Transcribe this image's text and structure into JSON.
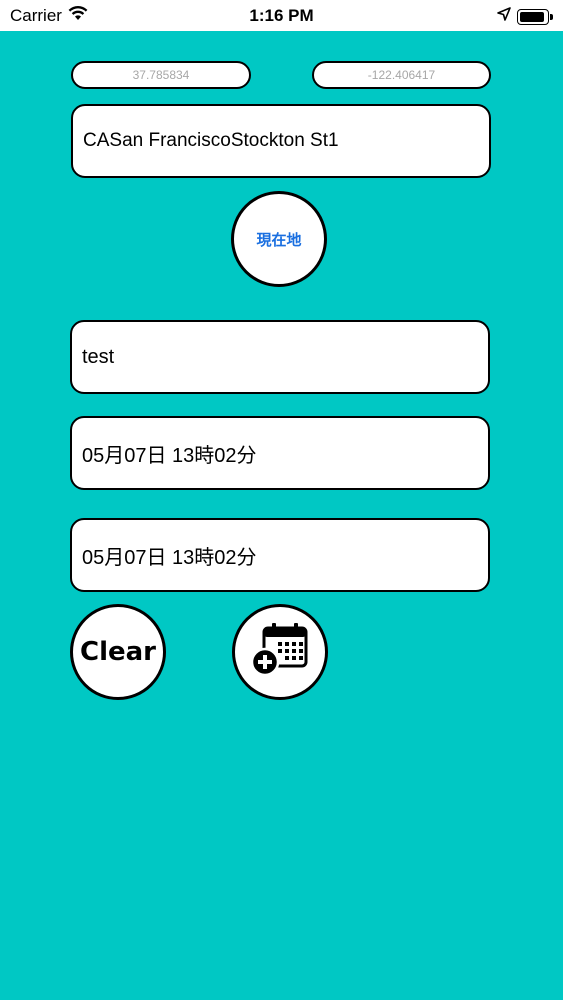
{
  "status_bar": {
    "carrier": "Carrier",
    "time": "1:16 PM"
  },
  "location": {
    "latitude": "37.785834",
    "longitude": "-122.406417",
    "address": "CASan FranciscoStockton St1",
    "current_location_button": "現在地"
  },
  "form": {
    "title_value": "test",
    "start_datetime": "05月07日 13時02分",
    "end_datetime": "05月07日 13時02分"
  },
  "actions": {
    "clear_label": "Clear",
    "add_calendar_icon": "calendar-add-icon"
  },
  "colors": {
    "background": "#00c8c4",
    "button_text_blue": "#1a6fe0"
  }
}
